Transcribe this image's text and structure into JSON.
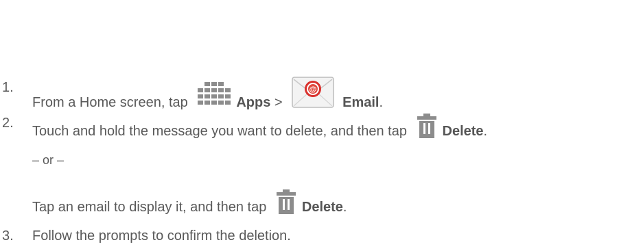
{
  "steps": [
    {
      "number": "1.",
      "text_before": "From a Home screen, tap ",
      "apps_label": "Apps",
      "separator": " > ",
      "email_label": "Email",
      "text_after": "."
    },
    {
      "number": "2.",
      "text_before": "Touch and hold the message you want to delete, and then tap ",
      "delete_label": "Delete",
      "text_after": "."
    },
    {
      "or_text": "– or –"
    },
    {
      "text_before": "Tap an email to display it, and then tap ",
      "delete_label": "Delete",
      "text_after": "."
    },
    {
      "number": "3.",
      "text": "Follow the prompts to confirm the deletion."
    }
  ],
  "icons": {
    "apps": "apps-grid-icon",
    "email": "email-envelope-icon",
    "delete": "trash-icon"
  },
  "colors": {
    "text": "#595959",
    "icon_gray": "#8c8c8c",
    "email_red": "#d9302c"
  }
}
